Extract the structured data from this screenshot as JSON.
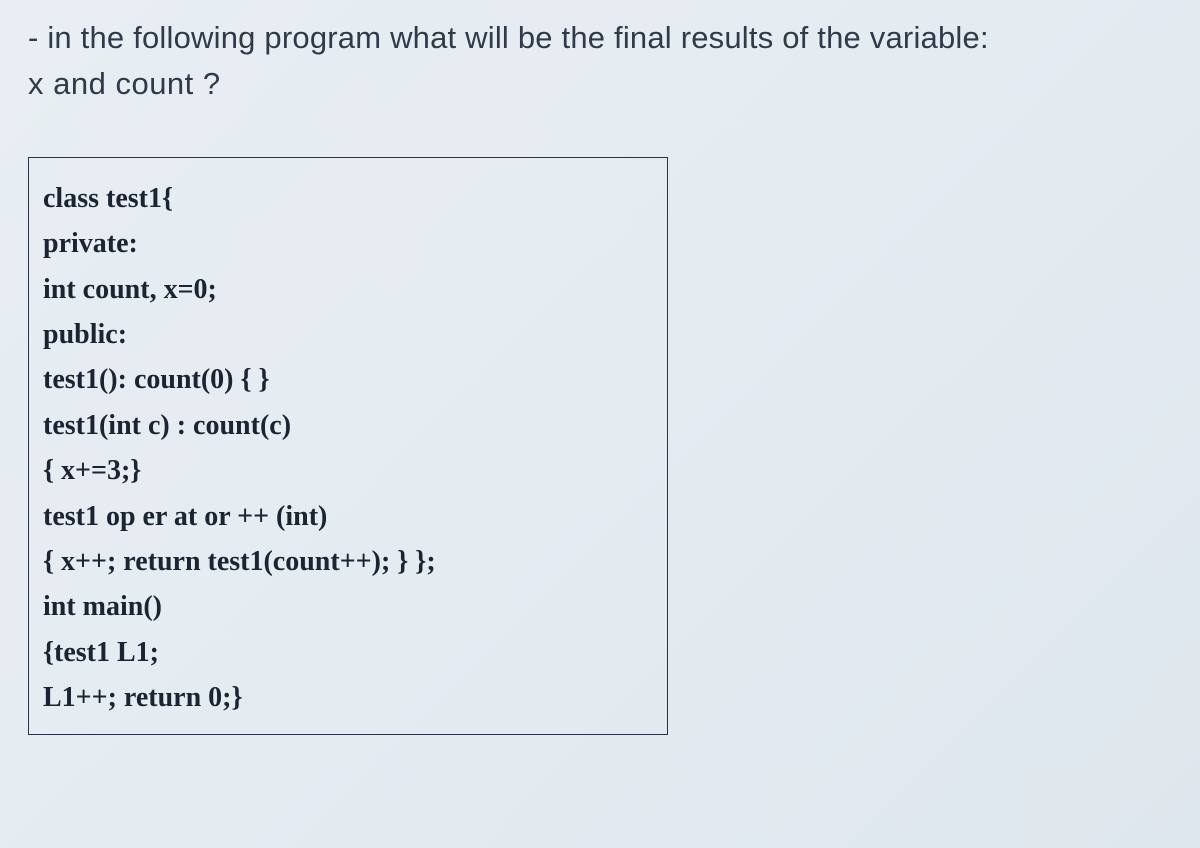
{
  "question": {
    "line1": "- in the following program what will be the final results of the variable:",
    "line2": "x  and  count ?"
  },
  "code": {
    "lines": [
      "class test1{",
      "private:",
      "int count, x=0;",
      "public:",
      "test1(): count(0) { }",
      "test1(int c) : count(c)",
      "{ x+=3;}",
      "test1 op er at or ++ (int)",
      "{ x++; return test1(count++); } };",
      "int main()",
      "{test1 L1;",
      "L1++; return 0;}"
    ]
  }
}
